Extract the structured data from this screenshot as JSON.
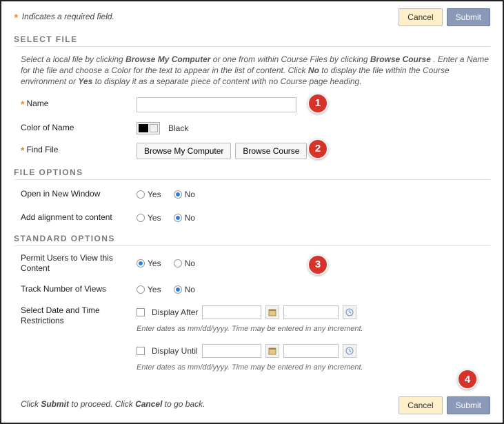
{
  "header": {
    "required_note": "Indicates a required field."
  },
  "buttons": {
    "cancel": "Cancel",
    "submit": "Submit"
  },
  "sections": {
    "select_file": {
      "title": "SELECT FILE",
      "instr": {
        "p1": "Select a local file by clicking ",
        "b1": "Browse My Computer",
        "p2": " or one from within Course Files by clicking ",
        "b2": "Browse Course",
        "p3": ". Enter a Name for the file and choose a Color for the text to appear in the list of content. Click ",
        "b3": "No",
        "p4": " to display the file within the Course environment or ",
        "b4": "Yes",
        "p5": " to display it as a separate piece of content with no Course page heading."
      }
    },
    "file_options": {
      "title": "FILE OPTIONS"
    },
    "standard_options": {
      "title": "STANDARD OPTIONS"
    }
  },
  "fields": {
    "name": {
      "label": "Name",
      "value": ""
    },
    "color_of_name": {
      "label": "Color of Name",
      "value": "Black"
    },
    "find_file": {
      "label": "Find File",
      "buttons": [
        "Browse My Computer",
        "Browse Course"
      ]
    },
    "open_new_window": {
      "label": "Open in New Window",
      "value": "No"
    },
    "add_alignment": {
      "label": "Add alignment to content",
      "value": "No"
    },
    "permit_view": {
      "label": "Permit Users to View this Content",
      "value": "Yes"
    },
    "track_views": {
      "label": "Track Number of Views",
      "value": "No"
    },
    "date_restrict": {
      "label": "Select Date and Time Restrictions",
      "display_after": "Display After",
      "display_until": "Display Until",
      "hint": "Enter dates as mm/dd/yyyy. Time may be entered in any increment."
    }
  },
  "radio_labels": {
    "yes": "Yes",
    "no": "No"
  },
  "footer": {
    "p1": "Click ",
    "b1": "Submit",
    "p2": " to proceed. Click ",
    "b2": "Cancel",
    "p3": " to go back."
  },
  "annotations": [
    "1",
    "2",
    "3",
    "4"
  ]
}
